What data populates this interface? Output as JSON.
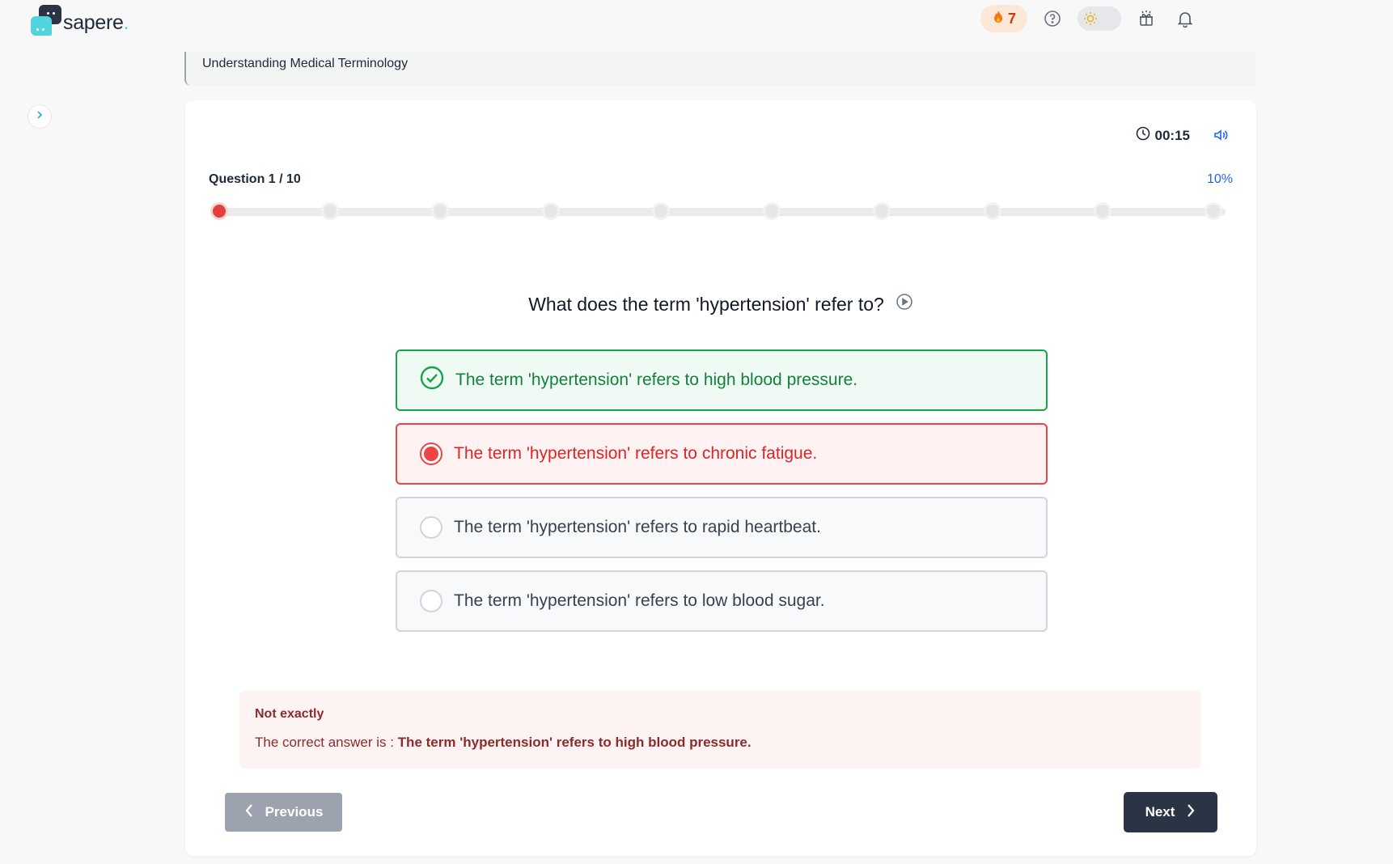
{
  "brand": {
    "name": "sapere",
    "dot": "."
  },
  "header": {
    "streak_count": "7",
    "streak_icon": "fire-icon",
    "icons": [
      "help-icon",
      "sun-icon",
      "gift-icon",
      "bell-icon"
    ]
  },
  "breadcrumb": {
    "title": "Understanding Medical Terminology"
  },
  "quiz": {
    "timer": "00:15",
    "question_label": "Question 1 / 10",
    "progress_text": "10%",
    "progress_fraction": 0.1,
    "total_questions": 10,
    "current_question": 1,
    "question": "What does the term 'hypertension' refer to?",
    "options": [
      {
        "text": "The term 'hypertension' refers to high blood pressure.",
        "state": "correct"
      },
      {
        "text": "The term 'hypertension' refers to chronic fatigue.",
        "state": "wrong"
      },
      {
        "text": "The term 'hypertension' refers to rapid heartbeat.",
        "state": "neutral"
      },
      {
        "text": "The term 'hypertension' refers to low blood sugar.",
        "state": "neutral"
      }
    ],
    "feedback": {
      "title": "Not exactly",
      "prefix": "The correct answer is : ",
      "answer": "The term 'hypertension' refers to high blood pressure."
    },
    "prev_label": "Previous",
    "next_label": "Next"
  },
  "colors": {
    "accent": "#2563eb",
    "correct": "#16a34a",
    "wrong": "#ef4444",
    "dark": "#2b3444",
    "brand_teal": "#53d3dc"
  }
}
